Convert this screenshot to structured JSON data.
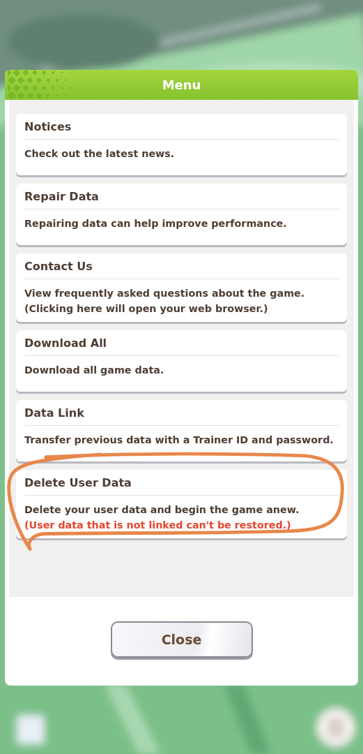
{
  "dialog": {
    "title": "Menu",
    "items": [
      {
        "title": "Notices",
        "circled": false,
        "lines": [
          {
            "kind": "normal",
            "text": "Check out the latest news."
          }
        ]
      },
      {
        "title": "Repair Data",
        "circled": false,
        "lines": [
          {
            "kind": "normal",
            "text": "Repairing data can help improve performance."
          }
        ]
      },
      {
        "title": "Contact Us",
        "circled": false,
        "lines": [
          {
            "kind": "normal",
            "text": "View frequently asked questions about the game."
          },
          {
            "kind": "normal",
            "text": "(Clicking here will open your web browser.)"
          }
        ]
      },
      {
        "title": "Download All",
        "circled": false,
        "lines": [
          {
            "kind": "normal",
            "text": "Download all game data."
          }
        ]
      },
      {
        "title": "Data Link",
        "circled": false,
        "lines": [
          {
            "kind": "normal",
            "text": "Transfer previous data with a Trainer ID and password."
          }
        ]
      },
      {
        "title": "Delete User Data",
        "circled": true,
        "lines": [
          {
            "kind": "normal",
            "text": "Delete your user data and begin the game anew."
          },
          {
            "kind": "warning",
            "text": "(User data that is not linked can't be restored.)"
          }
        ]
      }
    ],
    "close_button": "Close"
  }
}
